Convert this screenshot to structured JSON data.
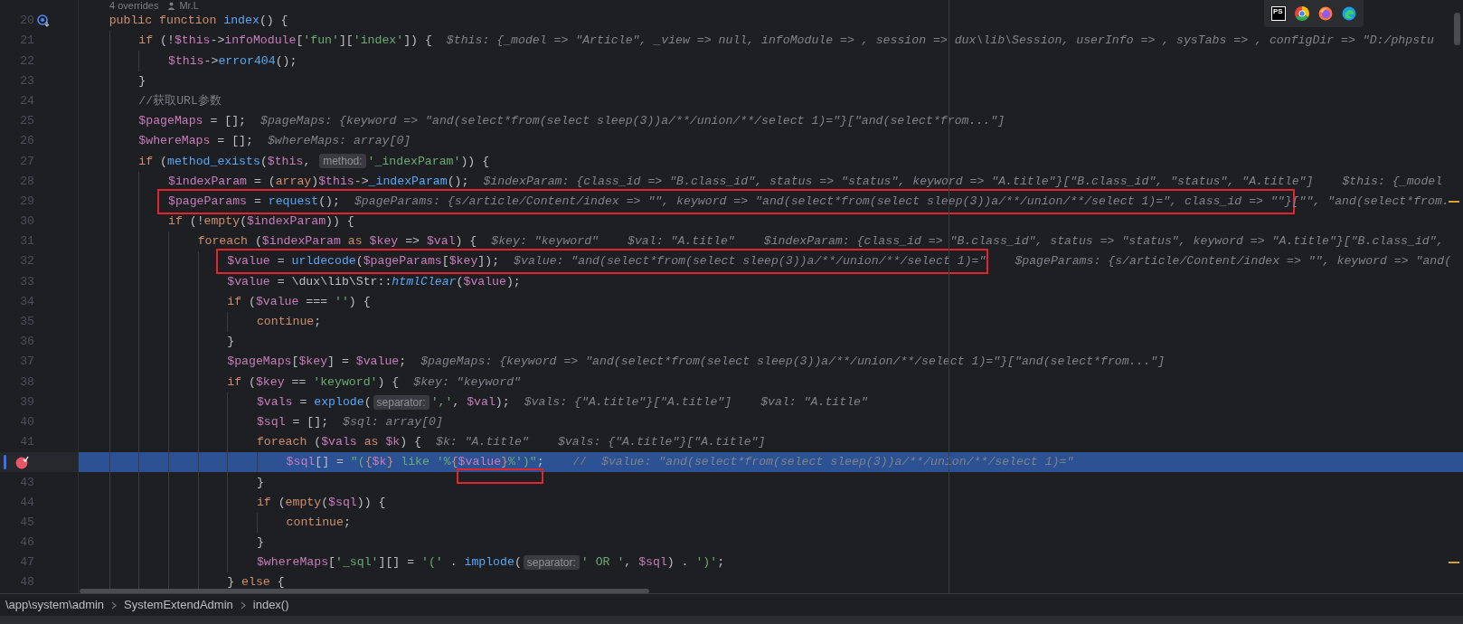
{
  "code_vision": {
    "usages": "4 overrides",
    "author": "Mr.L"
  },
  "toolbar": {
    "logo": "PS",
    "apps": [
      {
        "kind": "chrome"
      },
      {
        "kind": "firefox"
      },
      {
        "kind": "edge"
      }
    ]
  },
  "lines": [
    {
      "number": "20",
      "current": false,
      "warning": false,
      "marker": {
        "kind": "override"
      },
      "tokens": [
        {
          "kind": "kw",
          "text": "    public "
        },
        {
          "kind": "kw",
          "text": "function "
        },
        {
          "kind": "fn",
          "text": "index"
        },
        {
          "kind": "plain",
          "text": "() {"
        }
      ]
    },
    {
      "number": "21",
      "current": false,
      "warning": false,
      "tokens": [
        {
          "kind": "kw",
          "text": "        if "
        },
        {
          "kind": "plain",
          "text": "(!"
        },
        {
          "kind": "var",
          "text": "$this"
        },
        {
          "kind": "plain",
          "text": "->"
        },
        {
          "kind": "var",
          "text": "infoModule"
        },
        {
          "kind": "plain",
          "text": "["
        },
        {
          "kind": "str",
          "text": "'fun'"
        },
        {
          "kind": "plain",
          "text": "]["
        },
        {
          "kind": "str",
          "text": "'index'"
        },
        {
          "kind": "plain",
          "text": "]) {"
        }
      ],
      "hints": [
        {
          "text": "$this: {_model => \"Article\", _view => null, infoModule => , session => dux\\lib\\Session, userInfo => , sysTabs => , configDir => \"D:/phpstu"
        }
      ]
    },
    {
      "number": "22",
      "current": false,
      "warning": false,
      "tokens": [
        {
          "kind": "var",
          "text": "            $this"
        },
        {
          "kind": "plain",
          "text": "->"
        },
        {
          "kind": "fn",
          "text": "error404"
        },
        {
          "kind": "plain",
          "text": "();"
        }
      ]
    },
    {
      "number": "23",
      "current": false,
      "warning": false,
      "tokens": [
        {
          "kind": "plain",
          "text": "        }"
        }
      ]
    },
    {
      "number": "24",
      "current": false,
      "warning": false,
      "tokens": [
        {
          "kind": "comment",
          "text": "        //获取URL参数"
        }
      ]
    },
    {
      "number": "25",
      "current": false,
      "warning": false,
      "tokens": [
        {
          "kind": "var",
          "text": "        $pageMaps"
        },
        {
          "kind": "plain",
          "text": " = [];"
        }
      ],
      "hints": [
        {
          "text": "$pageMaps: {keyword => \"and(select*from(select sleep(3))a/**/union/**/select 1)=\"}[\"and(select*from...\"]"
        }
      ]
    },
    {
      "number": "26",
      "current": false,
      "warning": false,
      "tokens": [
        {
          "kind": "var",
          "text": "        $whereMaps"
        },
        {
          "kind": "plain",
          "text": " = [];"
        }
      ],
      "hints": [
        {
          "text": "$whereMaps: array[0]"
        }
      ]
    },
    {
      "number": "27",
      "current": false,
      "warning": false,
      "tokens": [
        {
          "kind": "kw",
          "text": "        if "
        },
        {
          "kind": "plain",
          "text": "("
        },
        {
          "kind": "fn",
          "text": "method_exists"
        },
        {
          "kind": "plain",
          "text": "("
        },
        {
          "kind": "var",
          "text": "$this"
        },
        {
          "kind": "plain",
          "text": ", "
        },
        {
          "kind": "param",
          "text": "method:"
        },
        {
          "kind": "str",
          "text": "'_indexParam'"
        },
        {
          "kind": "plain",
          "text": ")) {"
        }
      ]
    },
    {
      "number": "28",
      "current": false,
      "warning": false,
      "tokens": [
        {
          "kind": "var",
          "text": "            $indexParam"
        },
        {
          "kind": "plain",
          "text": " = ("
        },
        {
          "kind": "kw",
          "text": "array"
        },
        {
          "kind": "plain",
          "text": ")"
        },
        {
          "kind": "var",
          "text": "$this"
        },
        {
          "kind": "plain",
          "text": "->"
        },
        {
          "kind": "fn",
          "text": "_indexParam"
        },
        {
          "kind": "plain",
          "text": "();"
        }
      ],
      "hints": [
        {
          "text": "$indexParam: {class_id => \"B.class_id\", status => \"status\", keyword => \"A.title\"}[\"B.class_id\", \"status\", \"A.title\"]"
        },
        {
          "text": "$this: {_model"
        }
      ]
    },
    {
      "number": "29",
      "current": false,
      "warning": true,
      "boxed": true,
      "tokens": [
        {
          "kind": "var",
          "text": "            $pageParams"
        },
        {
          "kind": "plain",
          "text": " = "
        },
        {
          "kind": "fn",
          "text": "request"
        },
        {
          "kind": "plain",
          "text": "();"
        }
      ],
      "hints": [
        {
          "text": "$pageParams: {s/article/Content/index => \"\", keyword => \"and(select*from(select sleep(3))a/**/union/**/select 1)=\", class_id => \"\"}"
        },
        {
          "text": "[\"\", \"and(select*from.",
          "joined": true
        }
      ]
    },
    {
      "number": "30",
      "current": false,
      "warning": false,
      "tokens": [
        {
          "kind": "kw",
          "text": "            if "
        },
        {
          "kind": "plain",
          "text": "(!"
        },
        {
          "kind": "kw",
          "text": "empty"
        },
        {
          "kind": "plain",
          "text": "("
        },
        {
          "kind": "var",
          "text": "$indexParam"
        },
        {
          "kind": "plain",
          "text": ")) {"
        }
      ]
    },
    {
      "number": "31",
      "current": false,
      "warning": false,
      "tokens": [
        {
          "kind": "kw",
          "text": "                foreach "
        },
        {
          "kind": "plain",
          "text": "("
        },
        {
          "kind": "var",
          "text": "$indexParam"
        },
        {
          "kind": "kw",
          "text": " as "
        },
        {
          "kind": "var",
          "text": "$key"
        },
        {
          "kind": "plain",
          "text": " => "
        },
        {
          "kind": "var",
          "text": "$val"
        },
        {
          "kind": "plain",
          "text": ") {"
        }
      ],
      "hints": [
        {
          "text": "$key: \"keyword\""
        },
        {
          "text": "$val: \"A.title\""
        },
        {
          "text": "$indexParam: {class_id => \"B.class_id\", status => \"status\", keyword => \"A.title\"}[\"B.class_id\","
        }
      ]
    },
    {
      "number": "32",
      "current": false,
      "warning": false,
      "boxed": true,
      "tokens": [
        {
          "kind": "var",
          "text": "                    $value"
        },
        {
          "kind": "plain",
          "text": " = "
        },
        {
          "kind": "fn",
          "text": "urldecode"
        },
        {
          "kind": "plain",
          "text": "("
        },
        {
          "kind": "var",
          "text": "$pageParams"
        },
        {
          "kind": "plain",
          "text": "["
        },
        {
          "kind": "var",
          "text": "$key"
        },
        {
          "kind": "plain",
          "text": "]);"
        }
      ],
      "hints": [
        {
          "text": "$value: \"and(select*from(select sleep(3))a/**/union/**/select 1)=\""
        },
        {
          "text": "$pageParams: {s/article/Content/index => \"\", keyword => \"and("
        }
      ]
    },
    {
      "number": "33",
      "current": false,
      "warning": false,
      "tokens": [
        {
          "kind": "var",
          "text": "                    $value"
        },
        {
          "kind": "plain",
          "text": " = \\dux\\lib\\Str::"
        },
        {
          "kind": "fni",
          "text": "htmlClear"
        },
        {
          "kind": "plain",
          "text": "("
        },
        {
          "kind": "var",
          "text": "$value"
        },
        {
          "kind": "plain",
          "text": ");"
        }
      ]
    },
    {
      "number": "34",
      "current": false,
      "warning": false,
      "tokens": [
        {
          "kind": "kw",
          "text": "                    if "
        },
        {
          "kind": "plain",
          "text": "("
        },
        {
          "kind": "var",
          "text": "$value"
        },
        {
          "kind": "plain",
          "text": " === "
        },
        {
          "kind": "str",
          "text": "''"
        },
        {
          "kind": "plain",
          "text": ") {"
        }
      ]
    },
    {
      "number": "35",
      "current": false,
      "warning": false,
      "tokens": [
        {
          "kind": "kw",
          "text": "                        continue"
        },
        {
          "kind": "plain",
          "text": ";"
        }
      ]
    },
    {
      "number": "36",
      "current": false,
      "warning": false,
      "tokens": [
        {
          "kind": "plain",
          "text": "                    }"
        }
      ]
    },
    {
      "number": "37",
      "current": false,
      "warning": false,
      "tokens": [
        {
          "kind": "var",
          "text": "                    $pageMaps"
        },
        {
          "kind": "plain",
          "text": "["
        },
        {
          "kind": "var",
          "text": "$key"
        },
        {
          "kind": "plain",
          "text": "] = "
        },
        {
          "kind": "var",
          "text": "$value"
        },
        {
          "kind": "plain",
          "text": ";"
        }
      ],
      "hints": [
        {
          "text": "$pageMaps: {keyword => \"and(select*from(select sleep(3))a/**/union/**/select 1)=\"}[\"and(select*from...\"]"
        }
      ]
    },
    {
      "number": "38",
      "current": false,
      "warning": false,
      "tokens": [
        {
          "kind": "kw",
          "text": "                    if "
        },
        {
          "kind": "plain",
          "text": "("
        },
        {
          "kind": "var",
          "text": "$key"
        },
        {
          "kind": "plain",
          "text": " == "
        },
        {
          "kind": "str",
          "text": "'keyword'"
        },
        {
          "kind": "plain",
          "text": ") {"
        }
      ],
      "hints": [
        {
          "text": "$key: \"keyword\""
        }
      ]
    },
    {
      "number": "39",
      "current": false,
      "warning": false,
      "tokens": [
        {
          "kind": "var",
          "text": "                        $vals"
        },
        {
          "kind": "plain",
          "text": " = "
        },
        {
          "kind": "fn",
          "text": "explode"
        },
        {
          "kind": "plain",
          "text": "("
        },
        {
          "kind": "param",
          "text": "separator:"
        },
        {
          "kind": "str",
          "text": "','"
        },
        {
          "kind": "plain",
          "text": ", "
        },
        {
          "kind": "var",
          "text": "$val"
        },
        {
          "kind": "plain",
          "text": ");"
        }
      ],
      "hints": [
        {
          "text": "$vals: {\"A.title\"}[\"A.title\"]"
        },
        {
          "text": "$val: \"A.title\""
        }
      ]
    },
    {
      "number": "40",
      "current": false,
      "warning": false,
      "tokens": [
        {
          "kind": "var",
          "text": "                        $sql"
        },
        {
          "kind": "plain",
          "text": " = [];"
        }
      ],
      "hints": [
        {
          "text": "$sql: array[0]"
        }
      ]
    },
    {
      "number": "41",
      "current": false,
      "warning": false,
      "tokens": [
        {
          "kind": "kw",
          "text": "                        foreach "
        },
        {
          "kind": "plain",
          "text": "("
        },
        {
          "kind": "var",
          "text": "$vals"
        },
        {
          "kind": "kw",
          "text": " as "
        },
        {
          "kind": "var",
          "text": "$k"
        },
        {
          "kind": "plain",
          "text": ") {"
        }
      ],
      "hints": [
        {
          "text": "$k: \"A.title\""
        },
        {
          "text": "$vals: {\"A.title\"}[\"A.title\"]"
        }
      ]
    },
    {
      "current": true,
      "warning": false,
      "marker": {
        "kind": "breakpoint"
      },
      "tokens": [
        {
          "kind": "var",
          "text": "                            $sql"
        },
        {
          "kind": "plain",
          "text": "[] = "
        },
        {
          "kind": "str",
          "text": "\"("
        },
        {
          "kind": "brace",
          "text": "{"
        },
        {
          "kind": "var",
          "text": "$k"
        },
        {
          "kind": "brace",
          "text": "}"
        },
        {
          "kind": "str",
          "text": " like '%"
        },
        {
          "kind": "brace",
          "text": "{"
        },
        {
          "kind": "var",
          "text": "$value",
          "boxed": true
        },
        {
          "kind": "brace",
          "text": "}"
        },
        {
          "kind": "str",
          "text": "%')\""
        },
        {
          "kind": "plain",
          "text": ";"
        },
        {
          "kind": "comment",
          "text": "    //"
        }
      ],
      "hints": [
        {
          "text": "$value: \"and(select*from(select sleep(3))a/**/union/**/select 1)=\""
        }
      ]
    },
    {
      "number": "43",
      "current": false,
      "warning": false,
      "tokens": [
        {
          "kind": "plain",
          "text": "                        }"
        }
      ]
    },
    {
      "number": "44",
      "current": false,
      "warning": false,
      "tokens": [
        {
          "kind": "kw",
          "text": "                        if "
        },
        {
          "kind": "plain",
          "text": "("
        },
        {
          "kind": "kw",
          "text": "empty"
        },
        {
          "kind": "plain",
          "text": "("
        },
        {
          "kind": "var",
          "text": "$sql"
        },
        {
          "kind": "plain",
          "text": ")) {"
        }
      ]
    },
    {
      "number": "45",
      "current": false,
      "warning": false,
      "tokens": [
        {
          "kind": "kw",
          "text": "                            continue"
        },
        {
          "kind": "plain",
          "text": ";"
        }
      ]
    },
    {
      "number": "46",
      "current": false,
      "warning": false,
      "tokens": [
        {
          "kind": "plain",
          "text": "                        }"
        }
      ]
    },
    {
      "number": "47",
      "current": false,
      "warning": true,
      "tokens": [
        {
          "kind": "var",
          "text": "                        $whereMaps"
        },
        {
          "kind": "plain",
          "text": "["
        },
        {
          "kind": "str",
          "text": "'_sql'"
        },
        {
          "kind": "plain",
          "text": "][] = "
        },
        {
          "kind": "str",
          "text": "'('"
        },
        {
          "kind": "plain",
          "text": " . "
        },
        {
          "kind": "fn",
          "text": "implode"
        },
        {
          "kind": "plain",
          "text": "("
        },
        {
          "kind": "param",
          "text": "separator:"
        },
        {
          "kind": "str",
          "text": "' OR '"
        },
        {
          "kind": "plain",
          "text": ", "
        },
        {
          "kind": "var",
          "text": "$sql"
        },
        {
          "kind": "plain",
          "text": ") . "
        },
        {
          "kind": "str",
          "text": "')'"
        },
        {
          "kind": "plain",
          "text": ";"
        }
      ]
    },
    {
      "number": "48",
      "current": false,
      "warning": false,
      "tokens": [
        {
          "kind": "plain",
          "text": "                    } "
        },
        {
          "kind": "kw",
          "text": "else"
        },
        {
          "kind": "plain",
          "text": " {"
        }
      ]
    }
  ],
  "breadcrumb": [
    "\\app\\system\\admin",
    "SystemExtendAdmin",
    "index()"
  ]
}
